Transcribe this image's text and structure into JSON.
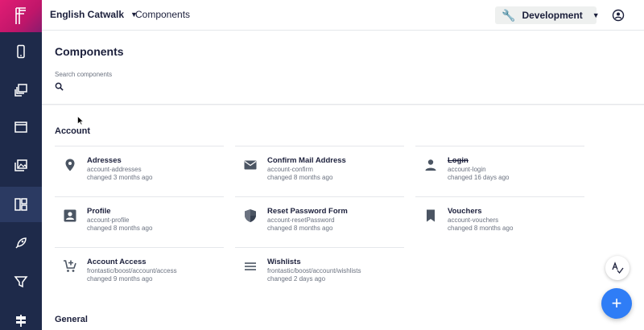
{
  "topbar": {
    "project": "English Catwalk",
    "breadcrumb": "Components",
    "environment": "Development"
  },
  "header": {
    "title": "Components",
    "search_label": "Search components",
    "search_value": ""
  },
  "sections": [
    {
      "title": "Account",
      "components": [
        {
          "name": "Adresses",
          "id": "account-addresses",
          "changed": "changed 3 months ago",
          "icon": "location-pin-icon"
        },
        {
          "name": "Confirm Mail Address",
          "id": "account-confirm",
          "changed": "changed 8 months ago",
          "icon": "mail-icon"
        },
        {
          "name": "Login",
          "id": "account-login",
          "changed": "changed 16 days ago",
          "icon": "person-icon",
          "deprecated": true
        },
        {
          "name": "Profile",
          "id": "account-profile",
          "changed": "changed 8 months ago",
          "icon": "profile-card-icon"
        },
        {
          "name": "Reset Password Form",
          "id": "account-resetPassword",
          "changed": "changed 8 months ago",
          "icon": "shield-icon"
        },
        {
          "name": "Vouchers",
          "id": "account-vouchers",
          "changed": "changed 8 months ago",
          "icon": "bookmark-icon"
        },
        {
          "name": "Account Access",
          "id": "frontastic/boost/account/access",
          "changed": "changed 9 months ago",
          "icon": "cart-add-icon"
        },
        {
          "name": "Wishlists",
          "id": "frontastic/boost/account/wishlists",
          "changed": "changed 2 days ago",
          "icon": "list-icon"
        }
      ]
    },
    {
      "title": "General",
      "components": []
    }
  ],
  "colors": {
    "sidebar": "#1e2a4a",
    "sidebar_active": "#2b3a62",
    "brand": "#e11d74",
    "environment_icon": "#2e9e3d",
    "fab": "#2f7df6"
  }
}
